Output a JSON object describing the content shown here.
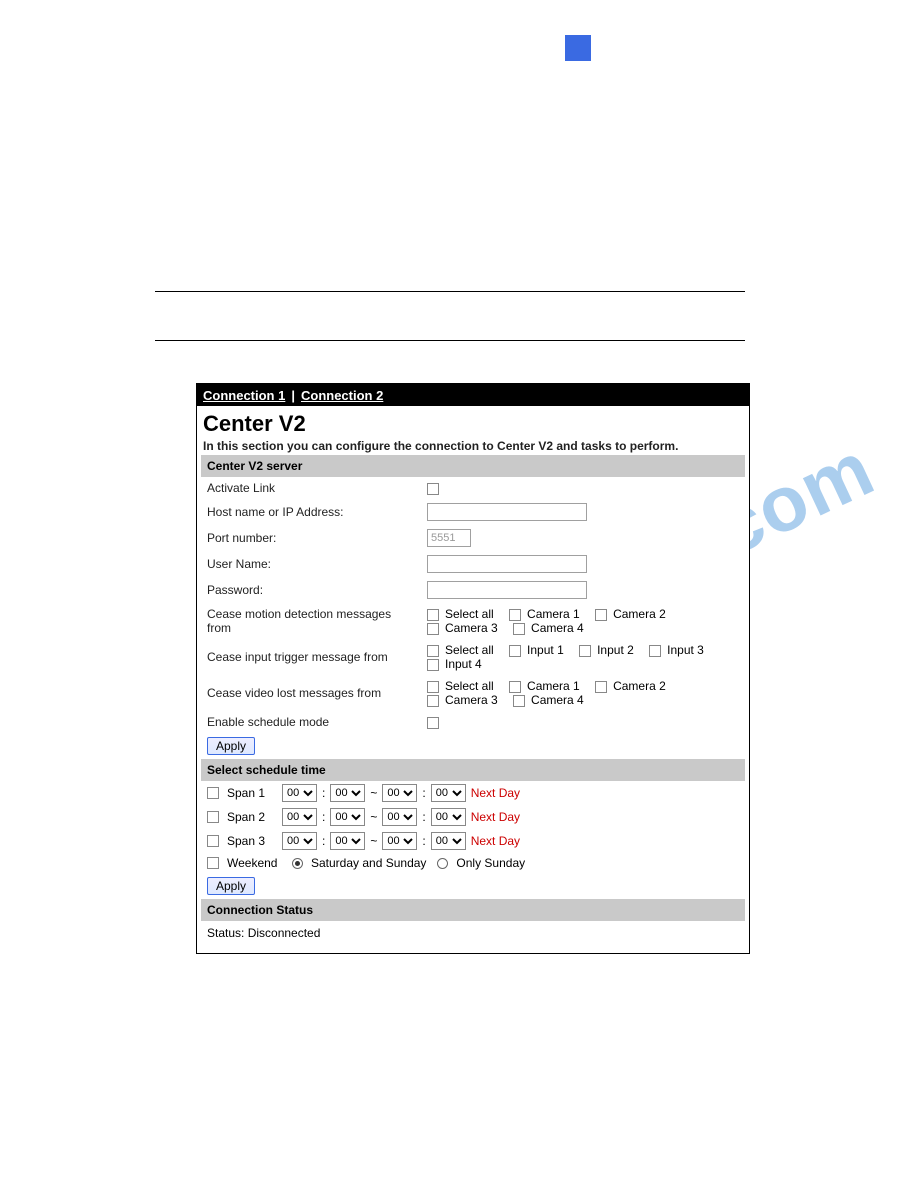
{
  "tabs": {
    "c1": "Connection 1",
    "c2": "Connection 2",
    "sep": "|"
  },
  "page": {
    "title": "Center V2",
    "desc": "In this section you can configure the connection to Center V2 and tasks to perform."
  },
  "section": {
    "server": "Center V2 server",
    "schedule": "Select schedule time",
    "status": "Connection Status"
  },
  "labels": {
    "activate": "Activate Link",
    "host": "Host name or IP Address:",
    "port": "Port number:",
    "user": "User Name:",
    "pass": "Password:",
    "ceaseMotion": "Cease motion detection messages from",
    "ceaseInput": "Cease input trigger message from",
    "ceaseLost": "Cease video lost messages from",
    "enableSched": "Enable schedule mode",
    "span1": "Span 1",
    "span2": "Span 2",
    "span3": "Span 3",
    "weekend": "Weekend",
    "satSun": "Saturday and Sunday",
    "onlySun": "Only Sunday",
    "nextDay": "Next Day",
    "apply": "Apply"
  },
  "values": {
    "port": "5551",
    "host": "",
    "user": "",
    "pass": "",
    "span": {
      "val": "00"
    },
    "status": "Status: Disconnected"
  },
  "opts": {
    "selectAll": "Select all",
    "cams": [
      "Camera 1",
      "Camera 2",
      "Camera 3",
      "Camera 4"
    ],
    "inputs": [
      "Input 1",
      "Input 2",
      "Input 3",
      "Input 4"
    ]
  },
  "glyph": {
    "tilde": "~",
    "colon": ":"
  }
}
